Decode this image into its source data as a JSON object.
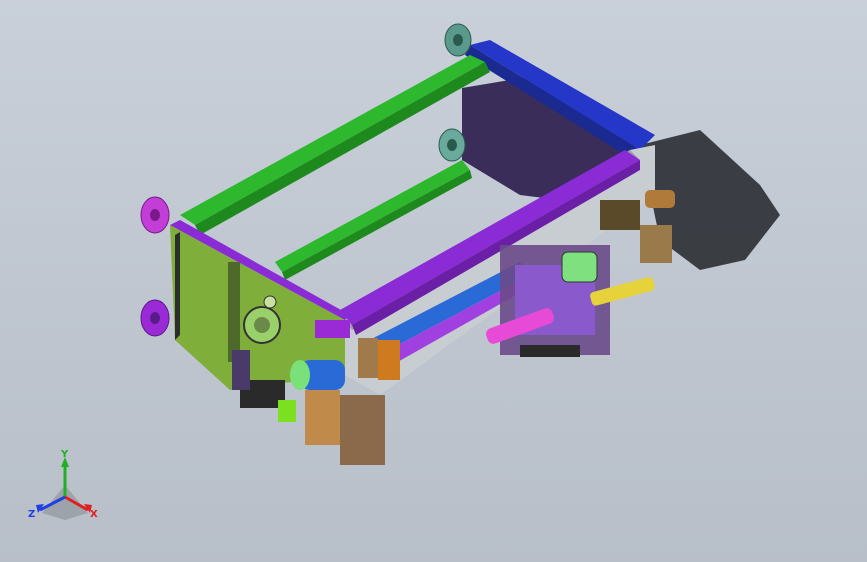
{
  "viewport": {
    "background_top": "#c9d0da",
    "background_bottom": "#b8bfc9"
  },
  "model": {
    "description_icon": "cad-assembly-isometric",
    "colors": {
      "frame_green": "#2eb82e",
      "frame_blue": "#2437c8",
      "frame_purple": "#8a2bd6",
      "plate_lime": "#7fae3a",
      "dark_panel": "#3b2d5a",
      "flange_magenta": "#c23ed6",
      "flange_teal": "#5a9a8c",
      "rail_gray": "#c8cdd2",
      "cylinder_pink": "#e84ad8",
      "cylinder_yellow": "#e6d23a",
      "motor_blue": "#2a6ad6",
      "bronze": "#b07a3a",
      "shadow": "#202428"
    }
  },
  "triad": {
    "x_label": "X",
    "y_label": "Y",
    "z_label": "Z",
    "x_color": "#e02020",
    "y_color": "#20b020",
    "z_color": "#2040e0"
  }
}
